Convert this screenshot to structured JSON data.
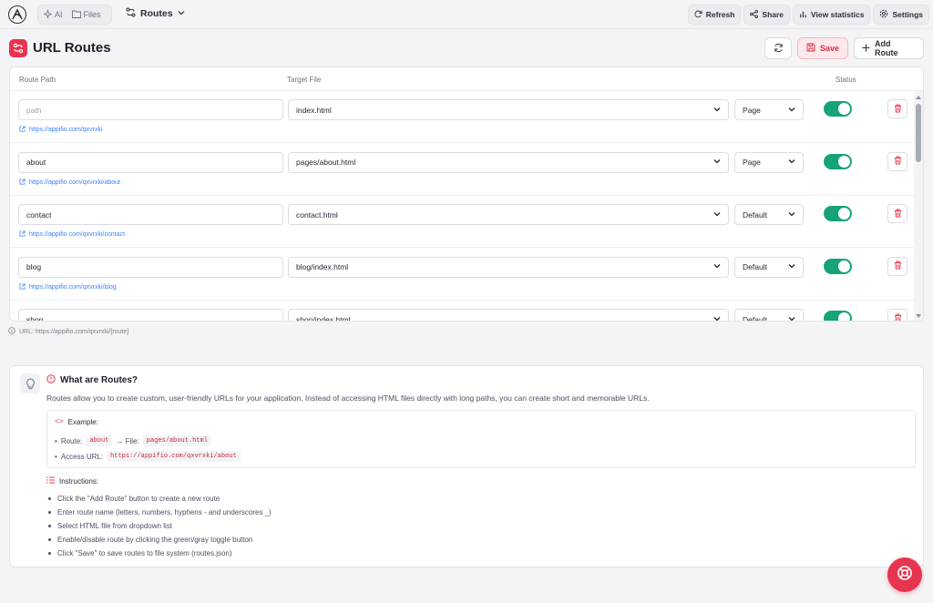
{
  "topbar": {
    "seg_items": [
      "AI",
      "Files"
    ],
    "crumb": "Routes",
    "buttons": [
      "Refresh",
      "Share",
      "View statistics",
      "Settings"
    ]
  },
  "header": {
    "title": "URL Routes",
    "save_label": "Save",
    "add_label": "Add Route"
  },
  "table": {
    "columns": [
      "Route Path",
      "Target File",
      "Status"
    ],
    "rows": [
      {
        "path": "",
        "placeholder": "path",
        "link": "https://appifio.com/qxvrxki",
        "file": "index.html",
        "type": "Page",
        "enabled": true
      },
      {
        "path": "about",
        "placeholder": "path",
        "link": "https://appifio.com/qxvrxki/about",
        "file": "pages/about.html",
        "type": "Page",
        "enabled": true
      },
      {
        "path": "contact",
        "placeholder": "path",
        "link": "https://appifio.com/qxvrxki/contact",
        "file": "contact.html",
        "type": "Default",
        "enabled": true
      },
      {
        "path": "blog",
        "placeholder": "path",
        "link": "https://appifio.com/qxvrxki/blog",
        "file": "blog/index.html",
        "type": "Default",
        "enabled": true
      },
      {
        "path": "shop",
        "placeholder": "path",
        "link": "",
        "file": "shop/index.html",
        "type": "Default",
        "enabled": true
      }
    ]
  },
  "url_note": "URL: https://appifio.com/qxvrxki/[route]",
  "info": {
    "title": "What are Routes?",
    "description": "Routes allow you to create custom, user-friendly URLs for your application. Instead of accessing HTML files directly with long paths, you can create short and memorable URLs.",
    "example_label": "Example:",
    "route_label": "Route:",
    "route_value": "about",
    "file_label": "→ File:",
    "file_value": "pages/about.html",
    "access_label": "Access URL:",
    "access_value": "https://appifio.com/qxvrxki/about",
    "instructions_label": "Instructions:",
    "instructions": [
      "Click the \"Add Route\" button to create a new route",
      "Enter route name (letters, numbers, hyphens - and underscores _)",
      "Select HTML file from dropdown list",
      "Enable/disable route by clicking the green/gray toggle button",
      "Click \"Save\" to save routes to file system (routes.json)"
    ]
  },
  "colors": {
    "accent": "#e8354f",
    "toggle_on": "#16a37a",
    "link": "#3b82f6"
  }
}
